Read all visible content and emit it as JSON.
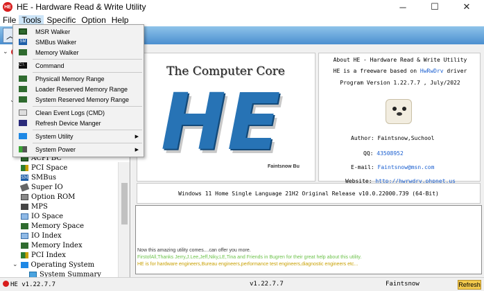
{
  "window": {
    "icon_text": "HE",
    "title": "HE - Hardware Read & Write Utility",
    "minimize": "─",
    "maximize": "☐",
    "close": "✕"
  },
  "menu": {
    "file": "File",
    "tools": "Tools",
    "specific": "Specific",
    "option": "Option",
    "help": "Help"
  },
  "tools_menu": {
    "msr_walker": "MSR Walker",
    "smbus_walker": "SMBus Walker",
    "memory_walker": "Memory Walker",
    "command": "Command",
    "physical_memory_range": "Physicall Memory Range",
    "loader_reserved": "Loader Reserved Memory Range",
    "system_reserved": "System Reserved Memory Range",
    "clean_event_logs": "Clean Event Logs (CMD)",
    "refresh_device": "Refresh Device Manger",
    "system_utility": "System Utility",
    "system_power": "System Power"
  },
  "tree": {
    "acpi": "ACPI BC",
    "pci_space": "PCI Space",
    "smbus": "SMBus",
    "super_io": "Super IO",
    "option_rom": "Option ROM",
    "mps": "MPS",
    "io_space": "IO Space",
    "memory_space": "Memory Space",
    "io_index": "IO Index",
    "memory_index": "Memory Index",
    "pci_index": "PCI Index",
    "operating_system": "Operating System",
    "system_summary": "System Summary"
  },
  "logo": {
    "caption": "The Computer Core",
    "big": "HE",
    "author": "Faintsnow Bu"
  },
  "about": {
    "heading": "About HE - Hardware Read & Write Utility",
    "freeware_prefix": "HE is a freeware based on ",
    "freeware_link": "HwRwDrv",
    "freeware_suffix": " driver",
    "version": "Program Version 1.22.7.7 , July/2022",
    "author_label": "Author:",
    "author_value": "Faintsnow,Suchool",
    "qq_label": "QQ:",
    "qq_value": "43508952",
    "email_label": "E-mail:",
    "email_value": "Faintsnow@msn.com",
    "website_label": "Website:",
    "website_value": "http://hwrwdrv.phpnet.us"
  },
  "os_info": "Windows 11 Home Single Language 21H2 Original Release v10.0.22000.739 (64-Bit)",
  "log": {
    "line1": "Now this amazing utility comes....can offer you more.",
    "line2": "FirstofAll,Thanks Jerry,J.Lee,Jeff,Niky,LE,Tina and Friends in Bugren for their great help about this utility.",
    "line3": "HE is for hardware engineers,Bureau engineers,performance test engineers,diagnostic engineers etc..."
  },
  "status": {
    "left": "HE v1.22.7.7",
    "center": "v1.22.7.7",
    "right": "Faintsnow",
    "refresh": "Refresh"
  }
}
